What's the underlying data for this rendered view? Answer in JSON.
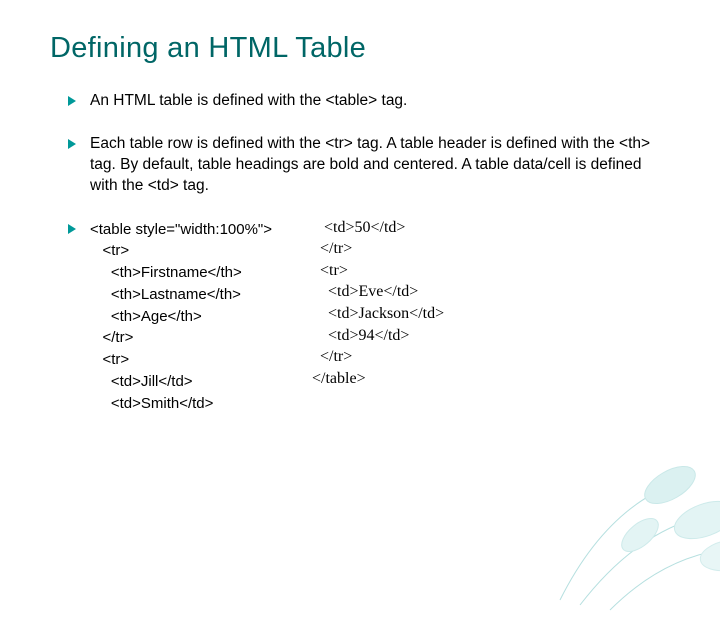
{
  "title": "Defining an HTML Table",
  "bullets": {
    "b1": "An HTML table is defined with the <table> tag.",
    "b2": "Each table row is defined with the <tr> tag. A table header is defined with the <th> tag. By default, table headings are bold and centered. A table data/cell is defined with the <td> tag."
  },
  "code_left": "<table style=\"width:100%\">\n   <tr>\n     <th>Firstname</th>\n     <th>Lastname</th>\n     <th>Age</th>\n   </tr>\n   <tr>\n     <td>Jill</td>\n     <td>Smith</td>",
  "code_right": "   <td>50</td>\n  </tr>\n  <tr>\n    <td>Eve</td>\n    <td>Jackson</td>\n    <td>94</td>\n  </tr>\n</table>"
}
